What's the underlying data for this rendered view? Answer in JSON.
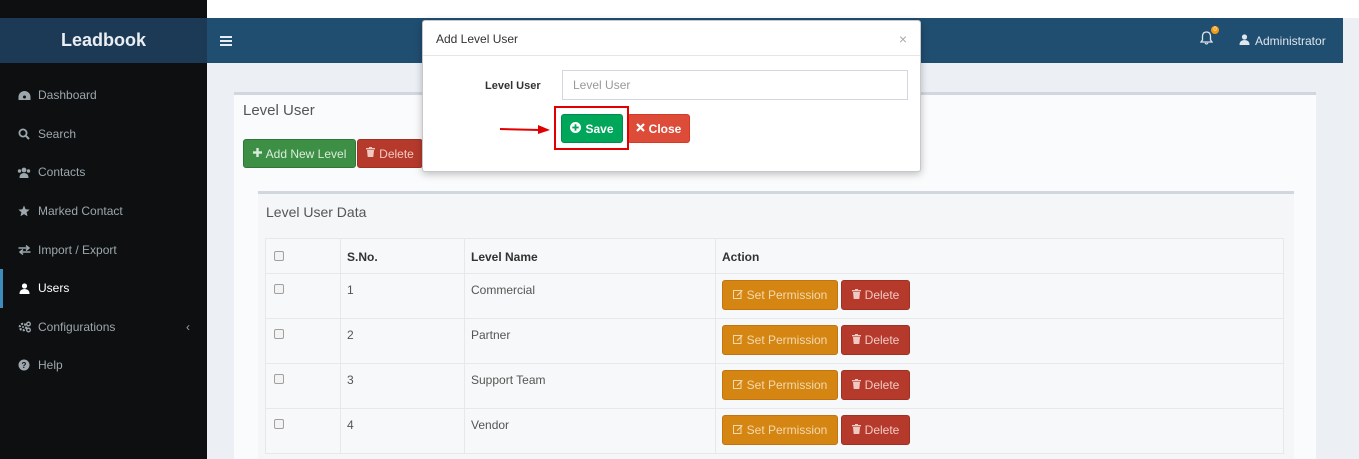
{
  "app": {
    "brand": "Leadbook"
  },
  "sidebar": {
    "items": [
      {
        "label": "Dashboard",
        "icon": "dashboard-icon"
      },
      {
        "label": "Search",
        "icon": "search-icon"
      },
      {
        "label": "Contacts",
        "icon": "users-icon"
      },
      {
        "label": "Marked Contact",
        "icon": "star-icon"
      },
      {
        "label": "Import / Export",
        "icon": "exchange-icon"
      },
      {
        "label": "Users",
        "icon": "user-icon",
        "active": true
      },
      {
        "label": "Configurations",
        "icon": "cogs-icon",
        "expandable": true
      },
      {
        "label": "Help",
        "icon": "question-icon"
      }
    ]
  },
  "navbar": {
    "user_label": "Administrator",
    "notification_count": "0"
  },
  "page": {
    "title": "Level User",
    "add_button": "Add New Level",
    "delete_button": "Delete",
    "data_title": "Level User Data"
  },
  "table": {
    "headers": [
      "",
      "S.No.",
      "Level Name",
      "Action"
    ],
    "rows": [
      {
        "sno": "1",
        "name": "Commercial"
      },
      {
        "sno": "2",
        "name": "Partner"
      },
      {
        "sno": "3",
        "name": "Support Team"
      },
      {
        "sno": "4",
        "name": "Vendor"
      }
    ],
    "permission_label": "Set Permission",
    "row_delete_label": "Delete"
  },
  "modal": {
    "title": "Add Level User",
    "close_glyph": "×",
    "field_label": "Level User",
    "field_placeholder": "Level User",
    "field_value": "",
    "save_label": "Save",
    "close_label": "Close"
  },
  "colors": {
    "navbar": "#204e71",
    "logo_bg": "#1c3a55",
    "sidebar": "#0d0f11",
    "save": "#00a65a",
    "close": "#dd4b39",
    "warning": "#d58512",
    "danger": "#b53a2c",
    "highlight": "#e00000"
  }
}
